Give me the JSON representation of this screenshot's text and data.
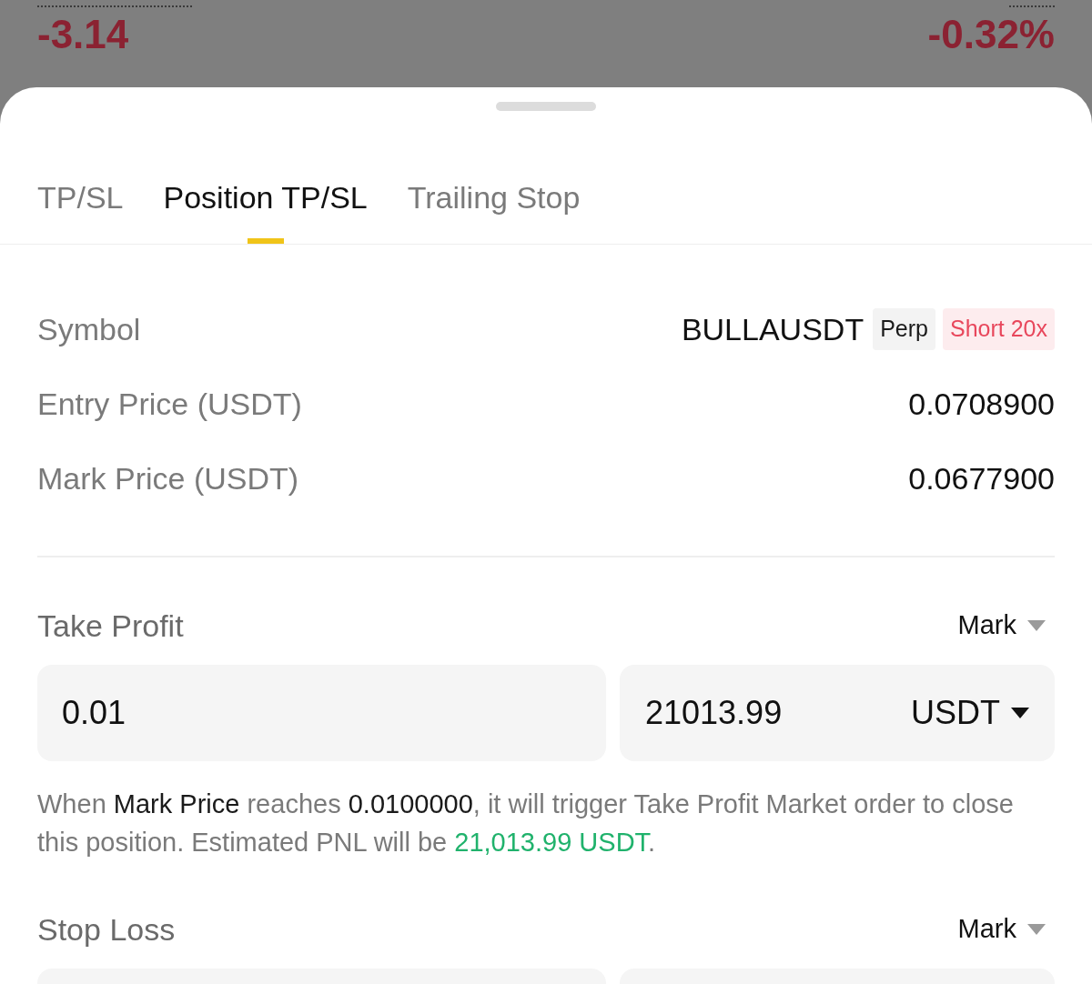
{
  "background": {
    "change": "-3.14",
    "change_percent": "-0.32%"
  },
  "tabs": [
    {
      "label": "TP/SL",
      "selected": false
    },
    {
      "label": "Position TP/SL",
      "selected": true
    },
    {
      "label": "Trailing Stop",
      "selected": false
    }
  ],
  "symbol": {
    "label": "Symbol",
    "value": "BULLAUSDT",
    "tags": [
      {
        "text": "Perp",
        "kind": "neutral"
      },
      {
        "text": "Short 20x",
        "kind": "short"
      }
    ]
  },
  "rows": [
    {
      "label": "Entry Price (USDT)",
      "value": "0.0708900"
    },
    {
      "label": "Mark Price (USDT)",
      "value": "0.0677900"
    }
  ],
  "take_profit": {
    "title": "Take Profit",
    "trigger_type": "Mark",
    "price": "0.01",
    "amount": "21013.99",
    "unit": "USDT",
    "note": [
      {
        "kind": "plain",
        "text": "When "
      },
      {
        "kind": "emph",
        "text": "Mark Price"
      },
      {
        "kind": "plain",
        "text": " reaches "
      },
      {
        "kind": "emph",
        "text": "0.0100000"
      },
      {
        "kind": "plain",
        "text": ", it will trigger Take Profit Market order to close this position. Estimated PNL will be "
      },
      {
        "kind": "profit",
        "text": "21,013.99 USDT"
      },
      {
        "kind": "plain",
        "text": "."
      }
    ]
  },
  "stop_loss": {
    "title": "Stop Loss",
    "trigger_type": "Mark"
  }
}
